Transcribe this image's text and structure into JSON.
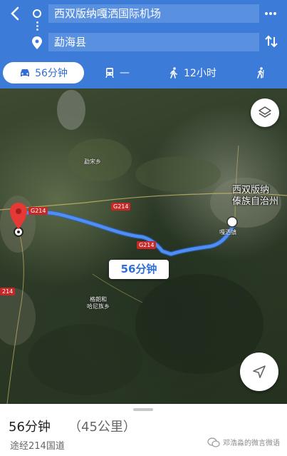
{
  "header": {
    "origin": "西双版纳嘎洒国际机场",
    "destination": "勐海县"
  },
  "modes": [
    {
      "label": "56分钟",
      "icon": "car-icon"
    },
    {
      "label": "—",
      "icon": "train-icon"
    },
    {
      "label": "12小时",
      "icon": "walk-icon"
    },
    {
      "label": "",
      "icon": "accessibility-icon"
    }
  ],
  "map": {
    "places": {
      "mengsong": "勐宋乡",
      "gelang": "格朗和\n哈尼族乡",
      "gasa": "嘎洒镇",
      "prefecture": "西双版纳\n傣族自治州"
    },
    "highways": {
      "g214_a": "G214",
      "g214_b": "G214",
      "g214_c": "G214",
      "g214_d": "214"
    },
    "route_time": "56分钟"
  },
  "summary": {
    "duration": "56分钟",
    "distance": "（45公里）",
    "via": "途经214国道",
    "watermark": "邓浩淼的微言微语"
  },
  "colors": {
    "accent": "#3d7bd9",
    "route": "#4f8ef5",
    "pin": "#e53935"
  }
}
